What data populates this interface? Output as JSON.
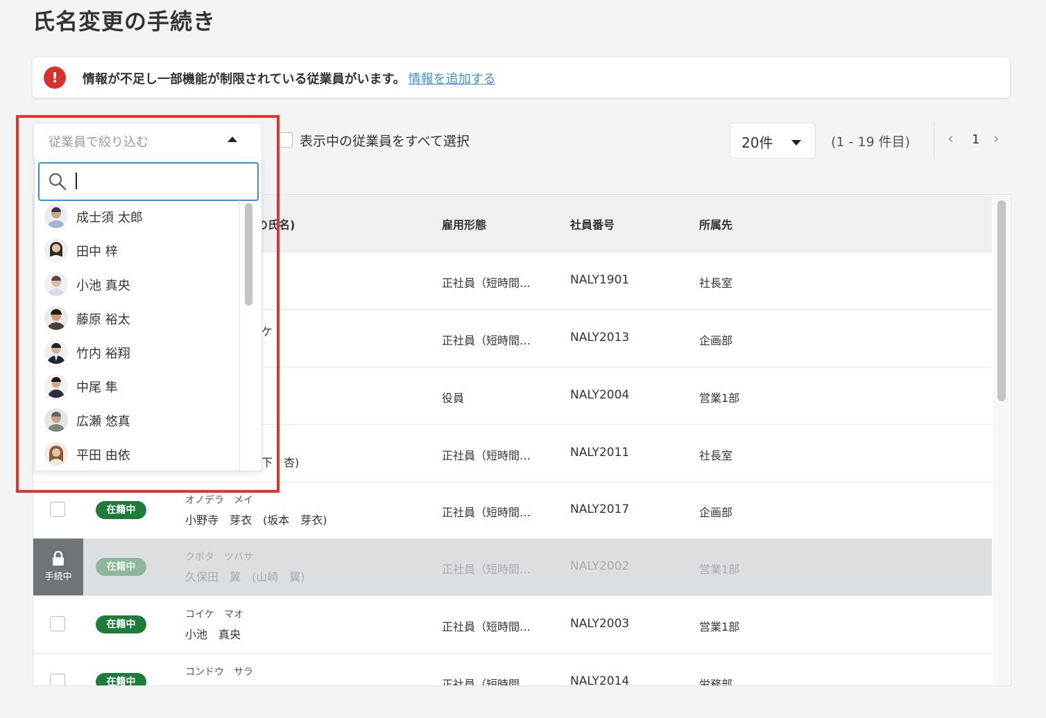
{
  "page": {
    "title": "氏名変更の手続き"
  },
  "alert": {
    "text": "情報が不足し一部機能が制限されている従業員がいます。",
    "link": "情報を追加する",
    "icon": "exclamation-icon",
    "icon_color": "#d9302c"
  },
  "toolbar": {
    "filter_placeholder": "従業員で絞り込む",
    "select_all_label": "表示中の従業員をすべて選択",
    "per_page": "20件",
    "range": "(1 - 19 件目)",
    "page": "1"
  },
  "dropdown": {
    "search_value": "",
    "employees": [
      {
        "name": "成士須 太郎"
      },
      {
        "name": "田中 梓"
      },
      {
        "name": "小池 真央"
      },
      {
        "name": "藤原 裕太"
      },
      {
        "name": "竹内 裕翔"
      },
      {
        "name": "中尾 隼"
      },
      {
        "name": "広瀬 悠真"
      },
      {
        "name": "平田 由依"
      }
    ]
  },
  "table": {
    "headers": {
      "name": "氏名)",
      "name_prefix": "の",
      "employment": "雇用形態",
      "employee_id": "社員番号",
      "department": "所属先"
    },
    "rows": [
      {
        "kana": "",
        "name": "",
        "status": "",
        "employment": "正社員（短時間…",
        "employee_id": "NALY1901",
        "department": "社長室"
      },
      {
        "kana": "",
        "name": "ケ",
        "status": "",
        "employment": "正社員（短時間…",
        "employee_id": "NALY2013",
        "department": "企画部"
      },
      {
        "kana": "",
        "name": "",
        "status": "",
        "employment": "役員",
        "employee_id": "NALY2004",
        "department": "営業1部"
      },
      {
        "kana": "",
        "name": "下　杏)",
        "status": "",
        "employment": "正社員（短時間…",
        "employee_id": "NALY2011",
        "department": "社長室"
      },
      {
        "kana": "オノデラ　メイ",
        "name": "小野寺　芽衣　(坂本　芽衣)",
        "status": "在籍中",
        "employment": "正社員（短時間…",
        "employee_id": "NALY2017",
        "department": "企画部"
      },
      {
        "kana": "クボタ　ツバサ",
        "name": "久保田　翼　(山崎　翼)",
        "status": "在籍中",
        "employment": "正社員（短時間…",
        "employee_id": "NALY2002",
        "department": "営業1部",
        "locked": true,
        "lock_label": "手続中"
      },
      {
        "kana": "コイケ　マオ",
        "name": "小池　真央",
        "status": "在籍中",
        "employment": "正社員（短時間…",
        "employee_id": "NALY2003",
        "department": "営業1部"
      },
      {
        "kana": "コンドウ　サラ",
        "name": "",
        "status": "在籍中",
        "employment": "正社員（短時間…",
        "employee_id": "NALY2014",
        "department": "労務部"
      }
    ]
  },
  "colors": {
    "accent": "#3b8ed8",
    "status_active": "#1e7c3a",
    "highlight": "#e53328",
    "lock": "#6f7479"
  }
}
